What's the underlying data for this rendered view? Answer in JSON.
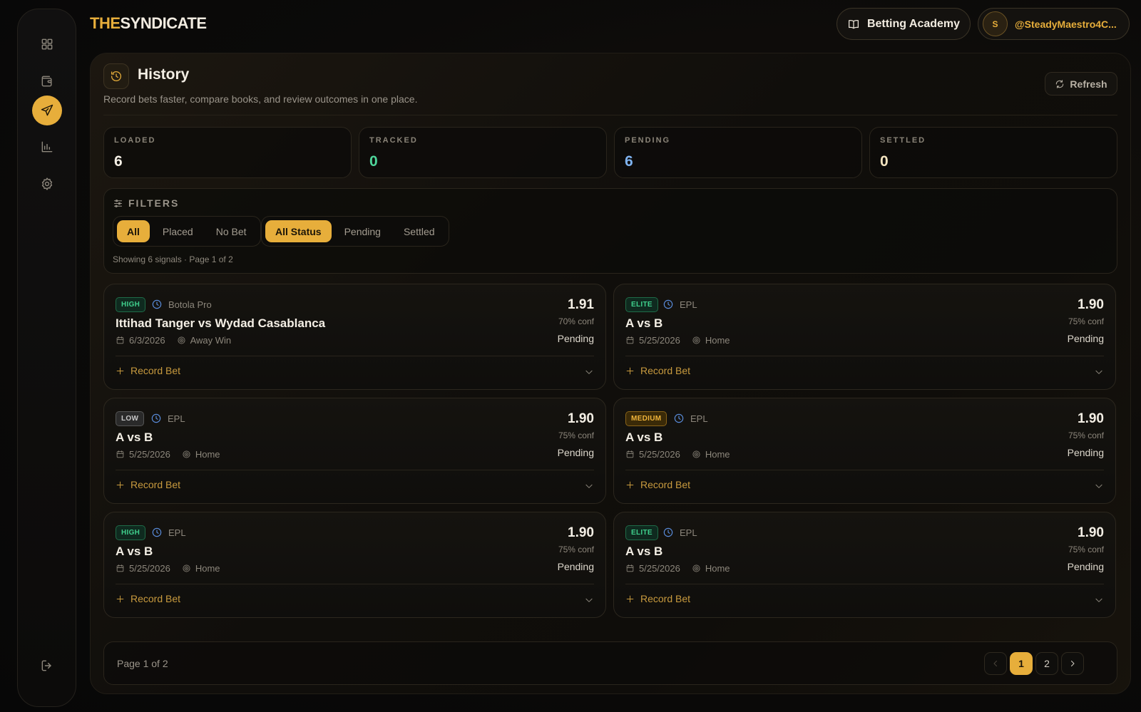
{
  "brand": {
    "part1": "THE",
    "part2": "SYNDICATE"
  },
  "header": {
    "academy_label": "Betting Academy",
    "avatar_initial": "S",
    "username": "@SteadyMaestro4C..."
  },
  "page": {
    "title": "History",
    "subtitle": "Record bets faster, compare books, and review outcomes in one place.",
    "refresh_label": "Refresh"
  },
  "stats": [
    {
      "label": "LOADED",
      "value": "6",
      "color": "#f4efe5"
    },
    {
      "label": "TRACKED",
      "value": "0",
      "color": "#4fd69b"
    },
    {
      "label": "PENDING",
      "value": "6",
      "color": "#7fb3f0"
    },
    {
      "label": "SETTLED",
      "value": "0",
      "color": "#f4e4c0"
    }
  ],
  "filters": {
    "heading": "FILTERS",
    "type_options": [
      "All",
      "Placed",
      "No Bet"
    ],
    "type_selected": "All",
    "status_options": [
      "All Status",
      "Pending",
      "Settled"
    ],
    "status_selected": "All Status",
    "showing": "Showing 6 signals · Page 1 of 2"
  },
  "cards": [
    {
      "badge": "HIGH",
      "badge_kind": "high",
      "league": "Botola Pro",
      "match": "Ittihad Tanger vs Wydad Casablanca",
      "date": "6/3/2026",
      "pick": "Away Win",
      "odds": "1.91",
      "conf": "70% conf",
      "status": "Pending",
      "record_label": "Record Bet"
    },
    {
      "badge": "ELITE",
      "badge_kind": "elite",
      "league": "EPL",
      "match": "A vs B",
      "date": "5/25/2026",
      "pick": "Home",
      "odds": "1.90",
      "conf": "75% conf",
      "status": "Pending",
      "record_label": "Record Bet"
    },
    {
      "badge": "LOW",
      "badge_kind": "low",
      "league": "EPL",
      "match": "A vs B",
      "date": "5/25/2026",
      "pick": "Home",
      "odds": "1.90",
      "conf": "75% conf",
      "status": "Pending",
      "record_label": "Record Bet"
    },
    {
      "badge": "MEDIUM",
      "badge_kind": "medium",
      "league": "EPL",
      "match": "A vs B",
      "date": "5/25/2026",
      "pick": "Home",
      "odds": "1.90",
      "conf": "75% conf",
      "status": "Pending",
      "record_label": "Record Bet"
    },
    {
      "badge": "HIGH",
      "badge_kind": "high",
      "league": "EPL",
      "match": "A vs B",
      "date": "5/25/2026",
      "pick": "Home",
      "odds": "1.90",
      "conf": "75% conf",
      "status": "Pending",
      "record_label": "Record Bet"
    },
    {
      "badge": "ELITE",
      "badge_kind": "elite",
      "league": "EPL",
      "match": "A vs B",
      "date": "5/25/2026",
      "pick": "Home",
      "odds": "1.90",
      "conf": "75% conf",
      "status": "Pending",
      "record_label": "Record Bet"
    }
  ],
  "pagination": {
    "label": "Page 1 of 2",
    "pages": [
      "1",
      "2"
    ],
    "current": "1"
  },
  "icons": {
    "nav": [
      "dashboard-icon",
      "wallet-icon",
      "send-icon",
      "bar-chart-icon",
      "gear-icon"
    ],
    "logout": "logout-icon"
  },
  "colors": {
    "accent": "#e7ae3b",
    "success": "#4fd69b",
    "info": "#7fb3f0"
  }
}
